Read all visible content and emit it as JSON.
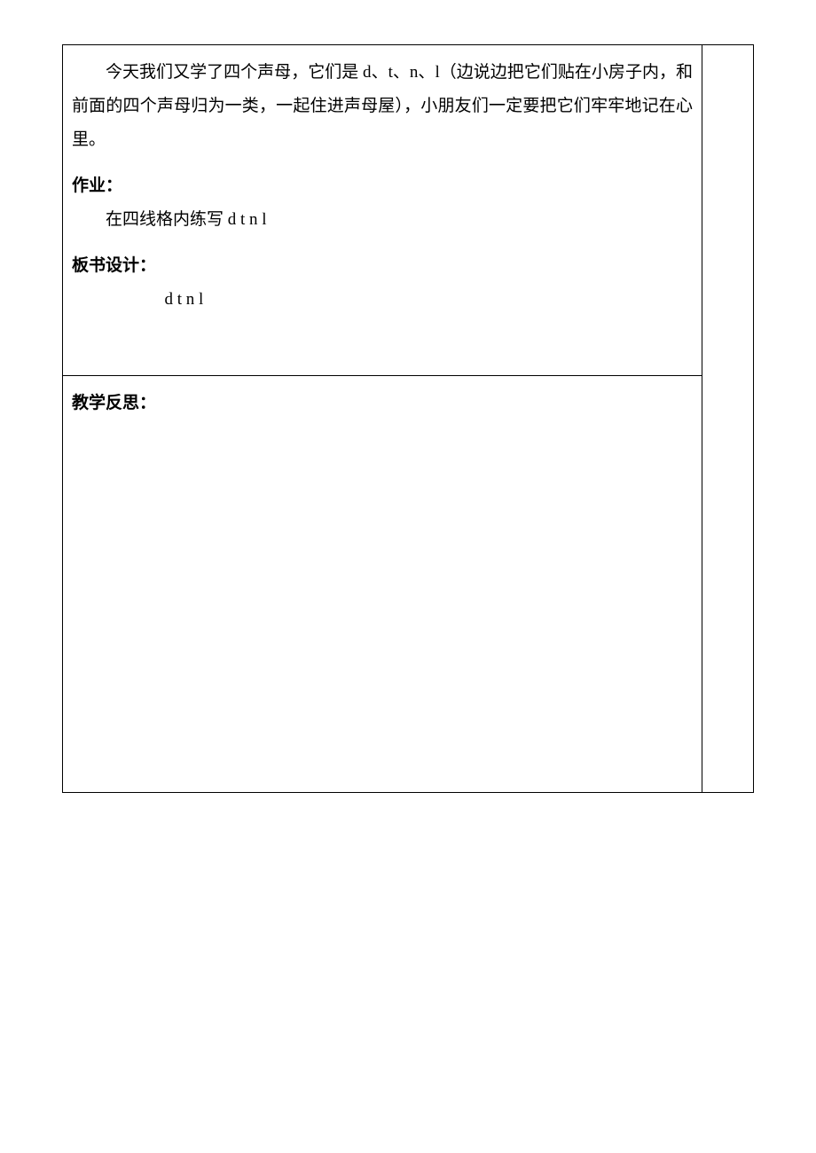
{
  "section_intro": {
    "paragraph": "今天我们又学了四个声母，它们是 d、t、n、l（边说边把它们贴在小房子内，和前面的四个声母归为一类，一起住进声母屋），小朋友们一定要把它们牢牢地记在心里。"
  },
  "homework": {
    "heading": "作业：",
    "content": "在四线格内练写 d t n l"
  },
  "board_design": {
    "heading": "板书设计：",
    "content": "d t n l"
  },
  "reflection": {
    "heading": "教学反思："
  }
}
